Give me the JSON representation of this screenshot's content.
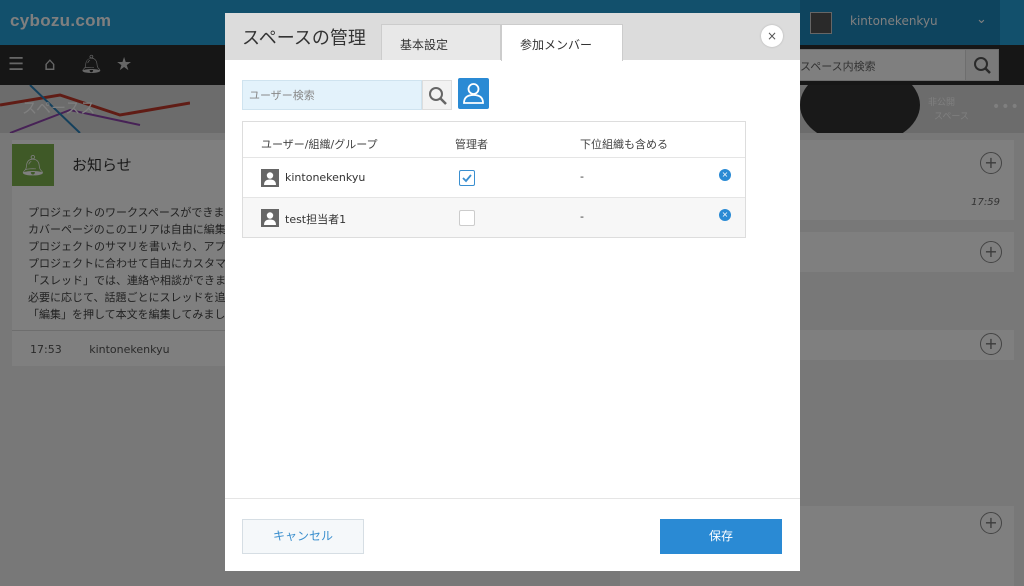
{
  "app": {
    "logo": "cybozu.com",
    "user_name": "kintonekenkyu",
    "space_search_placeholder": "スペース内検索",
    "banner_title": "スペースス",
    "banner_public_line1": "非公開",
    "banner_public_line2": "スペース",
    "banner_more": "•••",
    "notice_title": "お知らせ",
    "notice_lines": [
      "プロジェクトのワークスペースができま",
      "カバーページのこのエリアは自由に編集",
      "プロジェクトのサマリを書いたり、アプ",
      "プロジェクトに合わせて自由にカスタマ",
      "「スレッド」では、連絡や相談ができま",
      "必要に応じて、話題ごとにスレッドを追",
      "「編集」を押して本文を編集してみまし"
    ],
    "notice_time": "17:53",
    "notice_author": "kintonekenkyu",
    "right_card_time": "17:59"
  },
  "modal": {
    "title": "スペースの管理",
    "tabs": [
      {
        "label": "基本設定",
        "active": false
      },
      {
        "label": "参加メンバー",
        "active": true
      }
    ],
    "close_label": "×",
    "search_placeholder": "ユーザー検索",
    "table": {
      "headers": [
        "ユーザー/組織/グループ",
        "管理者",
        "下位組織も含める"
      ],
      "rows": [
        {
          "name": "kintonekenkyu",
          "is_admin": true,
          "include_sub": "-"
        },
        {
          "name": "test担当者1",
          "is_admin": false,
          "include_sub": "-"
        }
      ]
    },
    "cancel_label": "キャンセル",
    "save_label": "保存"
  },
  "colors": {
    "brand": "#25a0d8",
    "primary_button": "#2a8ad4",
    "search_bg": "#e3f2fb"
  }
}
